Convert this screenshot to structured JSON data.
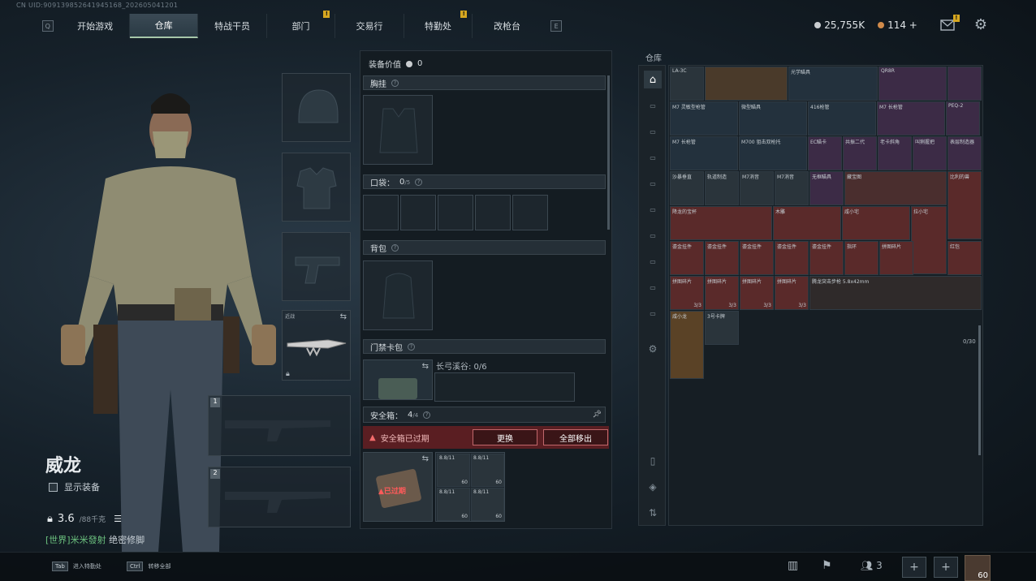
{
  "uid": "CN UID:909139852641945168_202605041201",
  "nav": {
    "key_left": "Q",
    "key_right": "E",
    "tabs": [
      {
        "label": "开始游戏",
        "active": false,
        "badge": false
      },
      {
        "label": "仓库",
        "active": true,
        "badge": false
      },
      {
        "label": "特战干员",
        "active": false,
        "badge": false
      },
      {
        "label": "部门",
        "active": false,
        "badge": true
      },
      {
        "label": "交易行",
        "active": false,
        "badge": false
      },
      {
        "label": "特勤处",
        "active": false,
        "badge": true
      },
      {
        "label": "改枪台",
        "active": false,
        "badge": false
      }
    ]
  },
  "currency": {
    "silver": "25,755K",
    "bonds": "114",
    "plus": "+"
  },
  "character": {
    "name": "威龙",
    "show_equipment": "显示装备",
    "weight": "3.6",
    "weight_max": "/88千克",
    "chat_channel": "[世界]",
    "chat_user": "米米發射",
    "chat_msg": "绝密修脚"
  },
  "left_slots": {
    "melee_label": "近战",
    "weapon1": "1",
    "weapon2": "2"
  },
  "mid": {
    "equip_value_label": "装备价值",
    "equip_value": "0",
    "chest_label": "胸挂",
    "pocket_label": "口袋：",
    "pocket_used": "0",
    "pocket_total": "/5",
    "backpack_label": "背包",
    "keycard_label": "门禁卡包",
    "keycard_area": "长弓溪谷: 0/6",
    "safe_label": "安全箱：",
    "safe_used": "4",
    "safe_total": "/4",
    "safe_expired": "安全箱已过期",
    "replace_btn": "更换",
    "remove_all_btn": "全部移出",
    "expired_tag": "已过期",
    "safe_items": [
      {
        "label": "8.8/11",
        "count": "60"
      },
      {
        "label": "8.8/11",
        "count": "60"
      },
      {
        "label": "8.8/11",
        "count": "60"
      },
      {
        "label": "8.8/11",
        "count": "60"
      }
    ]
  },
  "warehouse": {
    "title": "仓库",
    "capacity": "0/30",
    "items": {
      "r1": [
        "LA-3C",
        "",
        "光学瞄具",
        "QR8R",
        ""
      ],
      "r2": [
        "M7 灵敏型枪管",
        "微型瞄具",
        "416枪管",
        "M7 长枪管",
        "PEQ-2"
      ],
      "r3": [
        "M7 长枪管",
        "M700 狙击双枪托",
        "EC瞄卡",
        "共振二代",
        "老卡斜角",
        "叫猁握把",
        "表层制造器"
      ],
      "r4": [
        "沙暴垂直",
        "轨道制造",
        "M7消音",
        "M7消音",
        "无框瞄具",
        "藏宝图",
        "比利的兽"
      ],
      "r5": [
        "降龙的宝杯",
        "木雕",
        "咸小宅",
        "拉小宅"
      ],
      "r6": [
        "鎏金挂件",
        "鎏金挂件",
        "鎏金挂件",
        "鎏金挂件",
        "鎏金挂件",
        "指环",
        "拼图碎片",
        "红包"
      ],
      "r7": [
        "拼图碎片",
        "拼图碎片",
        "拼图碎片",
        "拼图碎片",
        "腾龙突击步枪 5.8x42mm"
      ],
      "r8": [
        "咸小龙",
        "3号卡牌"
      ],
      "stack": "3/3"
    }
  },
  "bottom": {
    "tab_key": "Tab",
    "tab_label": "进入特勤处",
    "ctrl_key": "Ctrl",
    "ctrl_label": "转移全部",
    "team_count": "3",
    "level": "60"
  }
}
